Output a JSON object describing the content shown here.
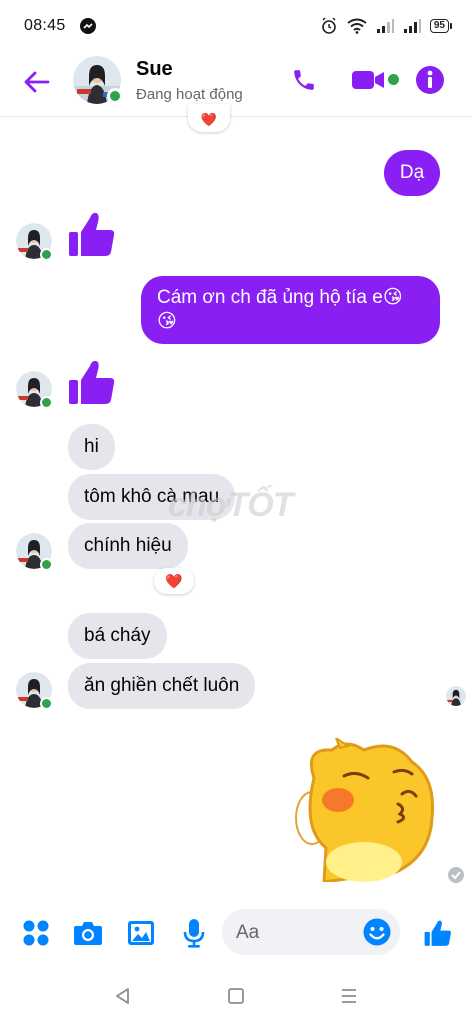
{
  "status_bar": {
    "time": "08:45",
    "battery": "95"
  },
  "header": {
    "contact_name": "Sue",
    "contact_status": "Đang hoạt động"
  },
  "messages": {
    "out_1": "Dạ",
    "out_2_line1": "Cám ơn ch đã ủng hộ tía e😘",
    "out_2_line2": "😘",
    "in_hi": "hi",
    "in_tom": "tôm khô cà mau",
    "in_chinh_hieu": "chính hiệu",
    "in_ba_chay": "bá cháy",
    "in_an_ghien": "ăn ghiền chết luôn"
  },
  "reactions": {
    "heart": "❤️"
  },
  "watermark": "chợTỐT",
  "composer": {
    "placeholder": "Aa"
  },
  "colors": {
    "accent": "#8a1ff3",
    "messenger_blue": "#0084ff",
    "incoming_bubble": "#e4e6eb",
    "online_green": "#31a24c"
  },
  "icons": {
    "back": "arrow-left-icon",
    "call": "phone-icon",
    "video": "video-camera-icon",
    "info": "info-icon",
    "like": "thumbs-up-icon",
    "apps": "four-dots-icon",
    "camera": "camera-icon",
    "gallery": "image-icon",
    "mic": "microphone-icon",
    "emoji": "smiley-icon",
    "seen": "check-circle-icon"
  }
}
